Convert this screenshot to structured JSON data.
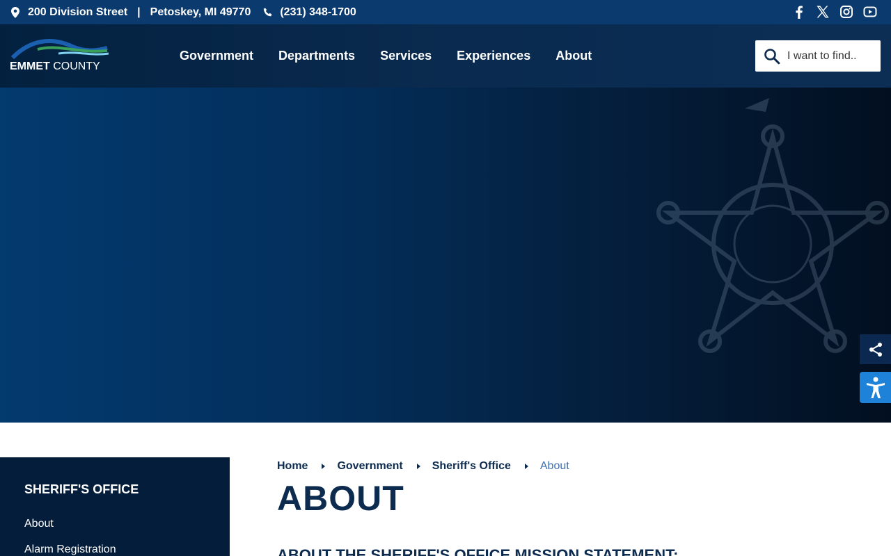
{
  "topbar": {
    "address": "200 Division Street",
    "separator": "|",
    "city": "Petoskey, MI 49770",
    "phone": "(231) 348-1700",
    "social_icons": [
      "facebook-icon",
      "x-icon",
      "instagram-icon",
      "youtube-icon"
    ]
  },
  "logo": {
    "text_bold": "EMMET",
    "text_rest": " COUNTY"
  },
  "nav": {
    "items": [
      "Government",
      "Departments",
      "Services",
      "Experiences",
      "About"
    ]
  },
  "search": {
    "placeholder": "I want to find.."
  },
  "sidebar": {
    "title": "SHERIFF'S OFFICE",
    "links": [
      "About",
      "Alarm Registration"
    ]
  },
  "breadcrumb": {
    "items": [
      "Home",
      "Government",
      "Sheriff's Office"
    ],
    "current": "About"
  },
  "main": {
    "title": "ABOUT",
    "subheading": "ABOUT THE SHERIFF'S OFFICE MISSION STATEMENT:"
  },
  "colors": {
    "topbar": "#0b3a6e",
    "header": "#03213f",
    "accent_blue": "#1e82d8",
    "text_dark": "#0d2b4e",
    "breadcrumb_current": "#3e6fb0"
  }
}
